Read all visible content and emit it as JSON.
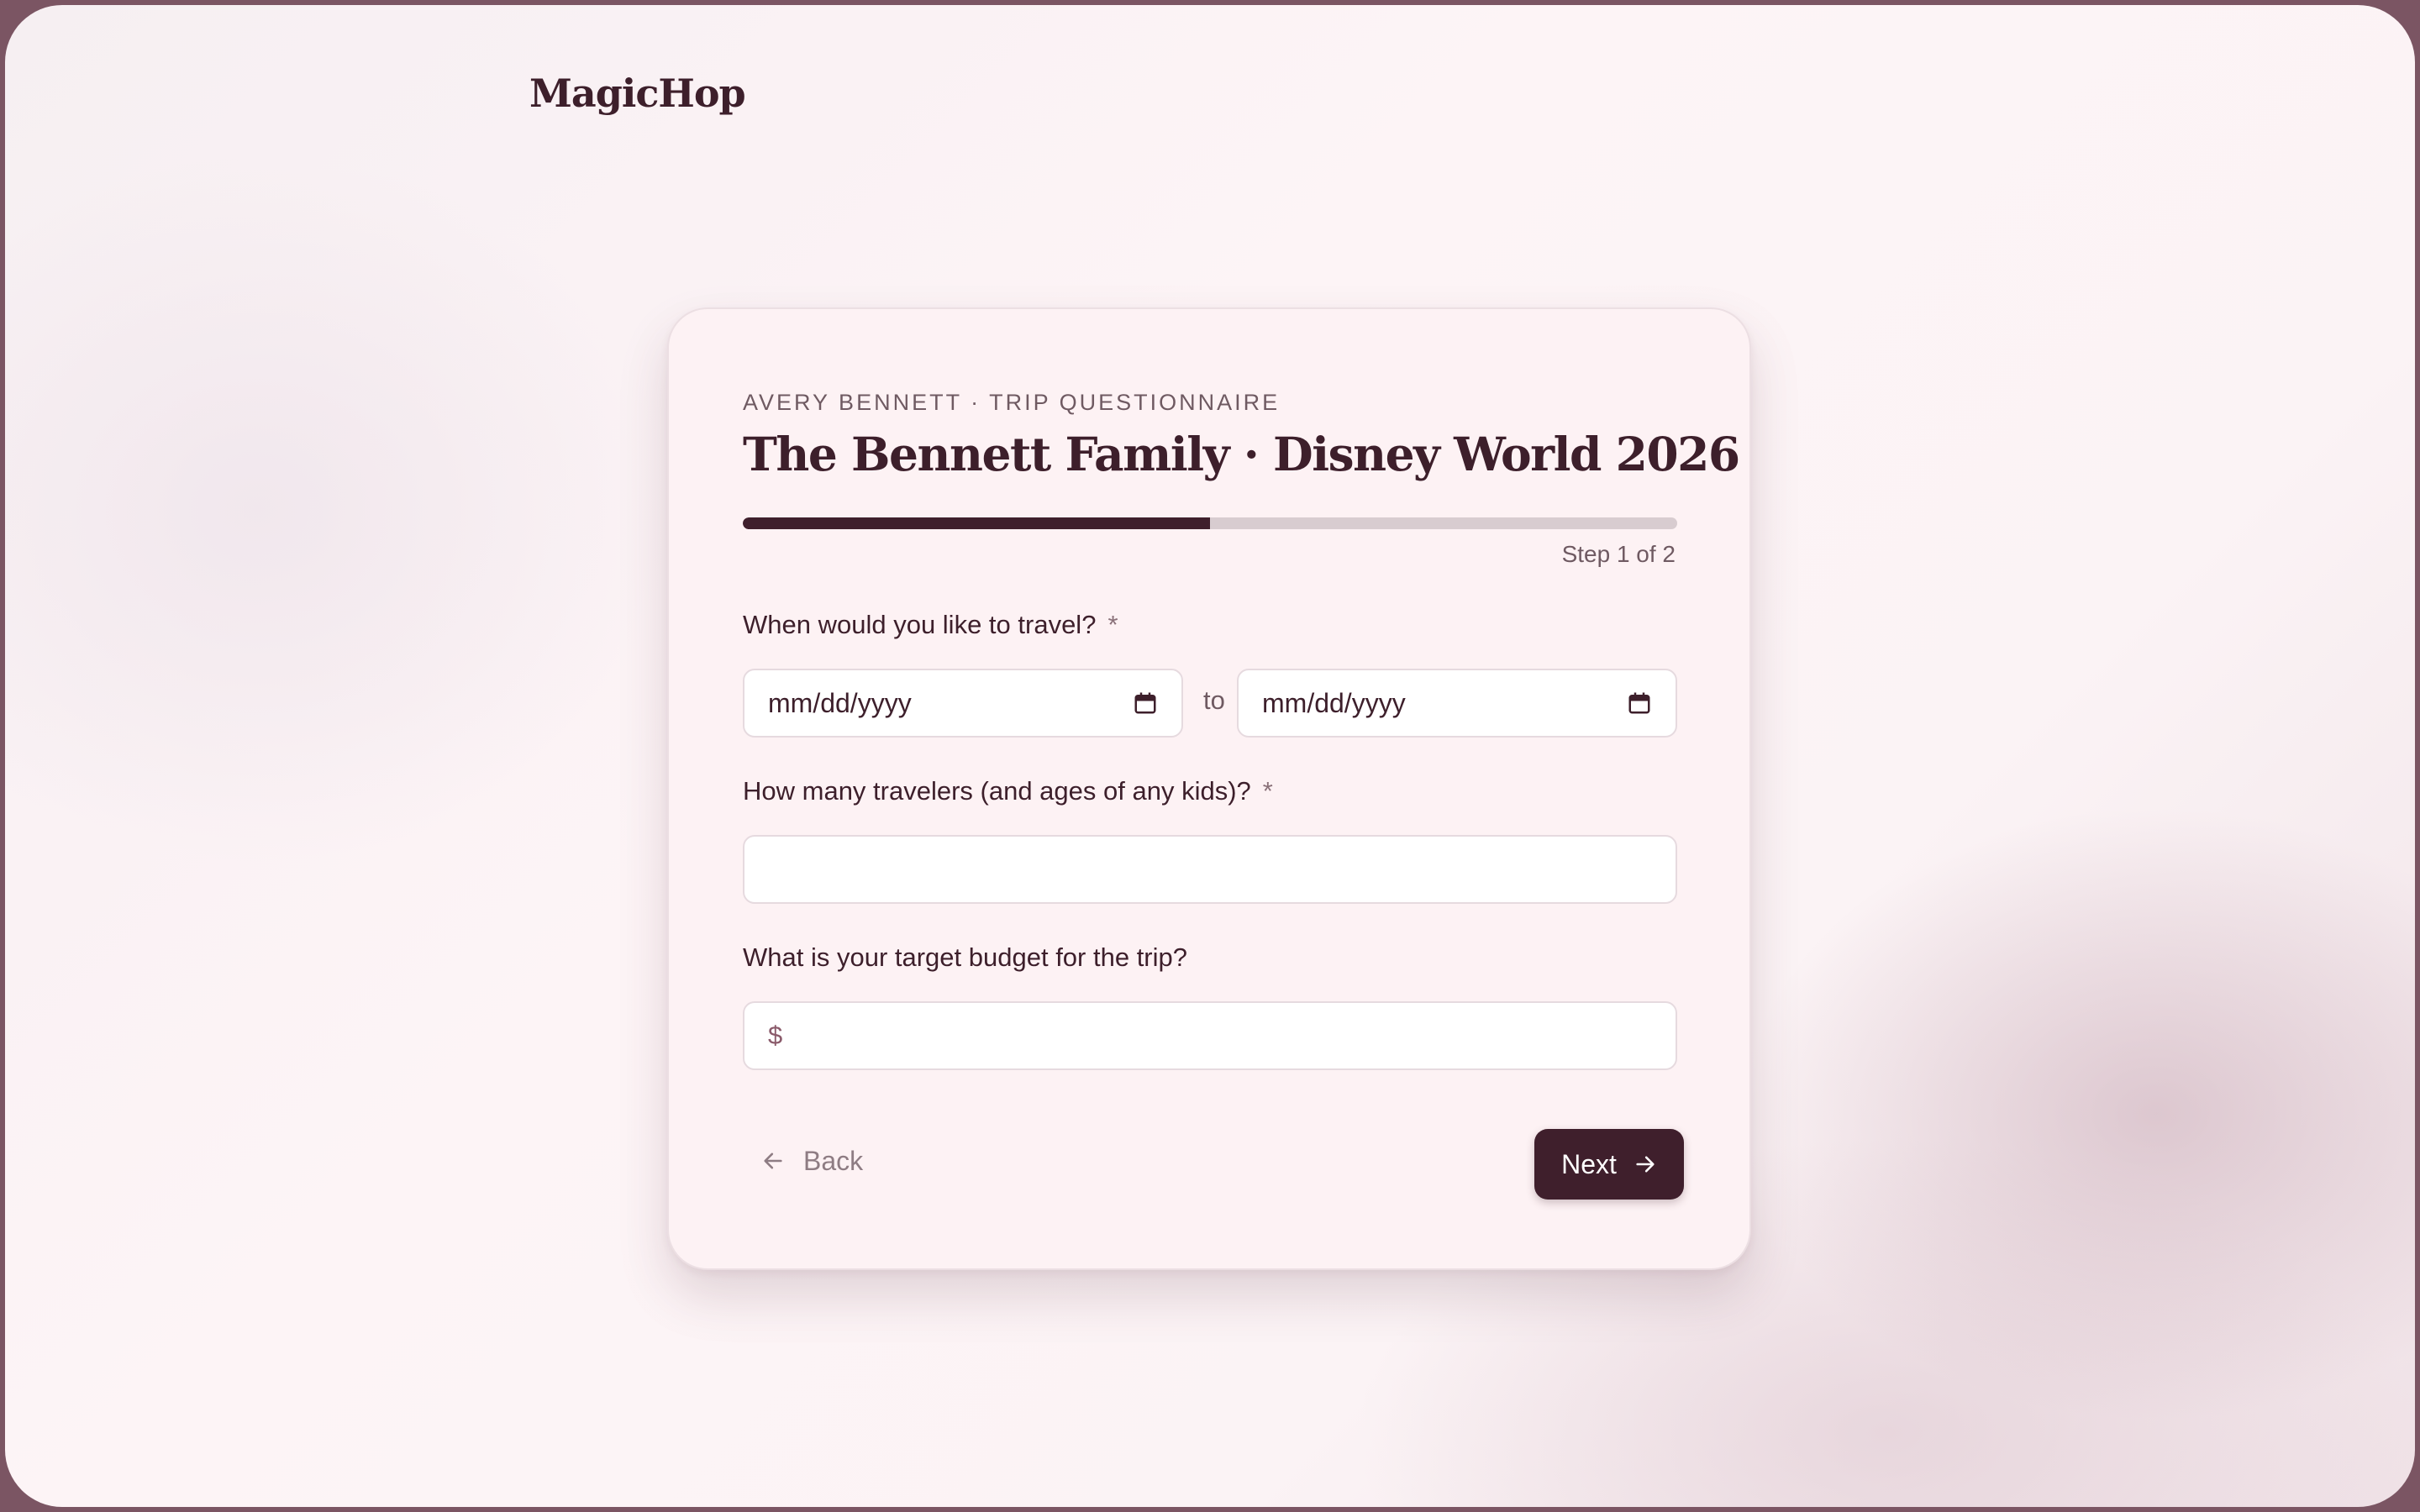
{
  "brand": {
    "name": "MagicHop"
  },
  "card": {
    "eyebrow": "AVERY BENNETT · TRIP QUESTIONNAIRE",
    "title": "The Bennett Family · Disney World 2026",
    "progress": {
      "fraction": 0.5,
      "step_label": "Step 1 of 2"
    }
  },
  "questions": {
    "travel_dates": {
      "label": "When would you like to travel?",
      "required_mark": "*",
      "start_placeholder": "mm/dd/yyyy",
      "separator": "to",
      "end_placeholder": "mm/dd/yyyy",
      "icon": "calendar-icon"
    },
    "travelers": {
      "label": "How many travelers (and ages of any kids)?",
      "required_mark": "*",
      "value": ""
    },
    "budget": {
      "label": "What is your target budget for the trip?",
      "prefix": "$",
      "value": ""
    }
  },
  "nav": {
    "back_label": "Back",
    "back_icon": "arrow-left-icon",
    "next_label": "Next",
    "next_icon": "arrow-right-icon"
  },
  "colors": {
    "accent": "#3f1f2c",
    "progress_track": "#d8ccd0",
    "card_bg": "#fdf2f4",
    "frame": "#7b5563"
  }
}
